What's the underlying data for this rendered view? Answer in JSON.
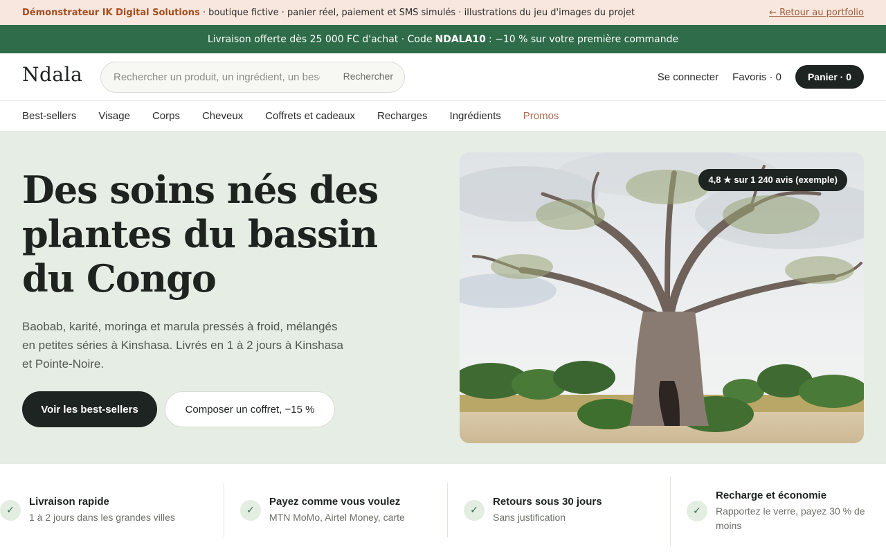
{
  "demo_bar": {
    "brand": "Démonstrateur IK Digital Solutions",
    "description": " · boutique fictive · panier réel, paiement et SMS simulés · illustrations du jeu d'images du projet",
    "back_link": "← Retour au portfolio"
  },
  "promo_bar": {
    "text_before": "Livraison offerte dès 25 000 FC d'achat · Code",
    "code": "NDALA10",
    "text_after": ": −10 % sur votre première commande"
  },
  "header": {
    "logo": "Ndala",
    "search_placeholder": "Rechercher un produit, un ingrédient, un besoin",
    "search_button": "Rechercher",
    "login": "Se connecter",
    "favorites": "Favoris · 0",
    "cart": "Panier · 0"
  },
  "nav": {
    "items": [
      "Best-sellers",
      "Visage",
      "Corps",
      "Cheveux",
      "Coffrets et cadeaux",
      "Recharges",
      "Ingrédients"
    ],
    "promo": "Promos"
  },
  "hero": {
    "title": "Des soins nés des plantes du bassin du Congo",
    "subtitle": "Baobab, karité, moringa et marula pressés à froid, mélangés en petites séries à Kinshasa. Livrés en 1 à 2 jours à Kinshasa et Pointe-Noire.",
    "primary_cta": "Voir les best-sellers",
    "secondary_cta": "Composer un coffret, −15 %",
    "rating_badge": "4,8 ★ sur 1 240 avis (exemple)"
  },
  "features": [
    {
      "title": "Livraison rapide",
      "subtitle": "1 à 2 jours dans les grandes villes"
    },
    {
      "title": "Payez comme vous voulez",
      "subtitle": "MTN MoMo, Airtel Money, carte"
    },
    {
      "title": "Retours sous 30 jours",
      "subtitle": "Sans justification"
    },
    {
      "title": "Recharge et économie",
      "subtitle": "Rapportez le verre, payez 30 % de moins"
    }
  ],
  "colors": {
    "accent_green": "#2f6c49",
    "dark": "#1e2421",
    "hero_bg": "#e6ede4",
    "demo_bg": "#f8e7de",
    "promo_link": "#b06a52"
  },
  "icons": {
    "feature_icon": "check-icon",
    "check_glyph": "✓"
  }
}
